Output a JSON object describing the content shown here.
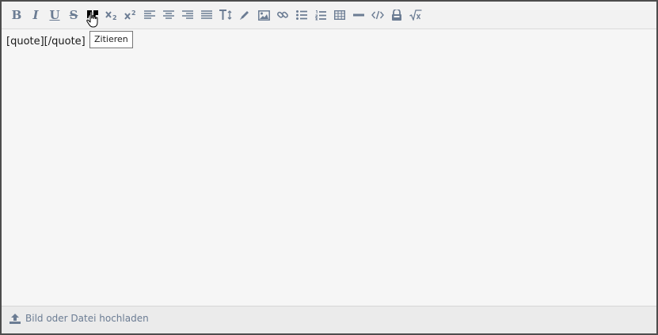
{
  "toolbar": {
    "buttons": [
      {
        "name": "bold-button",
        "icon": "bold-icon",
        "glyph": "B"
      },
      {
        "name": "italic-button",
        "icon": "italic-icon",
        "glyph": "I"
      },
      {
        "name": "underline-button",
        "icon": "underline-icon",
        "glyph": "U"
      },
      {
        "name": "strikethrough-button",
        "icon": "strikethrough-icon",
        "glyph": "S"
      },
      {
        "name": "quote-button",
        "icon": "quote-icon"
      },
      {
        "name": "subscript-button",
        "icon": "subscript-icon"
      },
      {
        "name": "superscript-button",
        "icon": "superscript-icon"
      },
      {
        "name": "align-left-button",
        "icon": "align-left-icon"
      },
      {
        "name": "align-center-button",
        "icon": "align-center-icon"
      },
      {
        "name": "align-right-button",
        "icon": "align-right-icon"
      },
      {
        "name": "justify-button",
        "icon": "align-justify-icon"
      },
      {
        "name": "font-size-button",
        "icon": "text-size-icon"
      },
      {
        "name": "color-button",
        "icon": "pencil-icon"
      },
      {
        "name": "image-button",
        "icon": "image-icon"
      },
      {
        "name": "link-button",
        "icon": "link-icon"
      },
      {
        "name": "bullet-list-button",
        "icon": "bullet-list-icon"
      },
      {
        "name": "numbered-list-button",
        "icon": "numbered-list-icon"
      },
      {
        "name": "table-button",
        "icon": "table-icon"
      },
      {
        "name": "horizontal-rule-button",
        "icon": "horizontal-rule-icon"
      },
      {
        "name": "code-button",
        "icon": "code-icon"
      },
      {
        "name": "spoiler-button",
        "icon": "spoiler-icon"
      },
      {
        "name": "math-button",
        "icon": "square-root-icon"
      }
    ],
    "tooltip": "Zitieren"
  },
  "editor": {
    "content": "[quote][/quote]"
  },
  "footer": {
    "upload_label": "Bild oder Datei hochladen",
    "upload_icon": "upload-icon"
  },
  "colors": {
    "icon": "#6b7c93",
    "active_icon": "#000000",
    "editor_background": "#f6f6f6",
    "toolbar_background": "#f2f2f2",
    "border": "#4d4d4d"
  }
}
